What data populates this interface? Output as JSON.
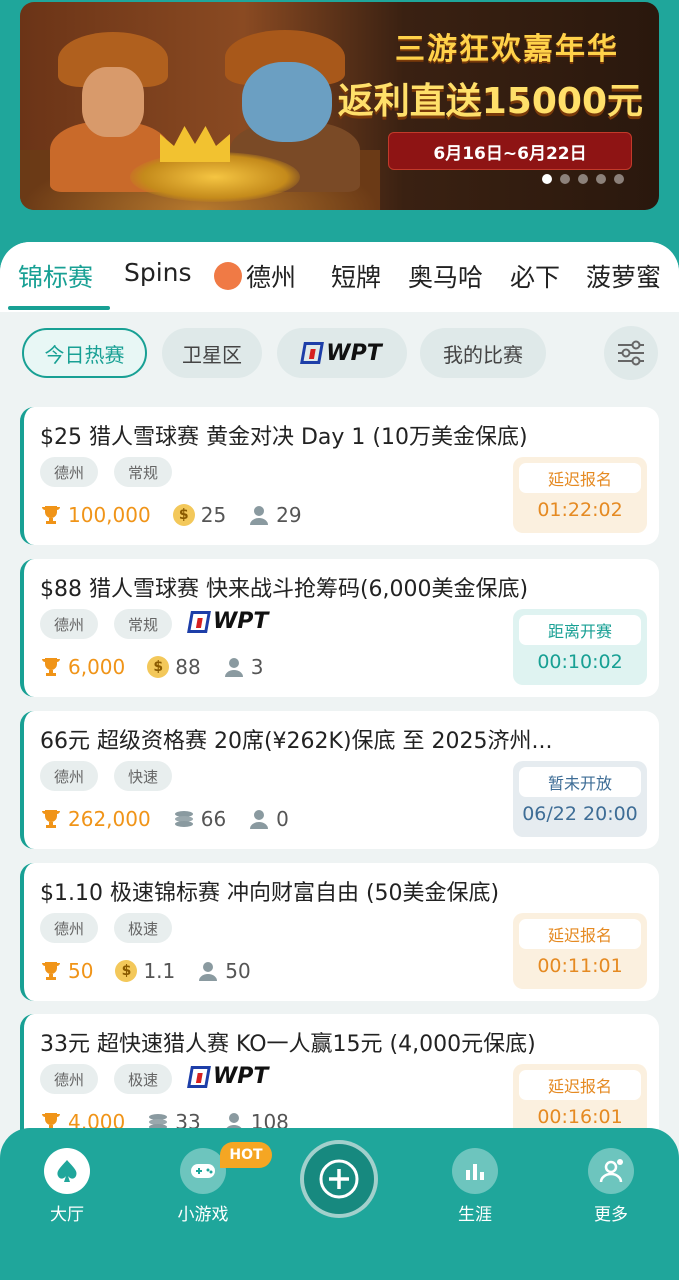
{
  "banner": {
    "headline_line1": "三游狂欢嘉年华",
    "headline_line2": "返利直送15000元",
    "date_range": "6月16日~6月22日",
    "slides": 5,
    "active_slide": 1
  },
  "tabs": [
    {
      "label": "锦标赛",
      "active": true
    },
    {
      "label": "Spins"
    },
    {
      "label": "德州",
      "icon": "octopus-icon"
    },
    {
      "label": "短牌"
    },
    {
      "label": "奥马哈"
    },
    {
      "label": "必下"
    },
    {
      "label": "菠萝蜜"
    }
  ],
  "filters": {
    "today": "今日热赛",
    "satellite": "卫星区",
    "wpt_logo_text": "WPT",
    "my_matches": "我的比赛",
    "settings_icon": "sliders-icon"
  },
  "cards": [
    {
      "title": "$25 猎人雪球赛 黄金对决 Day 1 (10万美金保底)",
      "tags": [
        "德州",
        "常规"
      ],
      "wpt": false,
      "prize": "100,000",
      "fee_icon": "coin",
      "fee": "25",
      "players": "29",
      "status": "延迟报名",
      "time": "01:22:02",
      "status_type": "late"
    },
    {
      "title": "$88 猎人雪球赛 快来战斗抢筹码(6,000美金保底)",
      "tags": [
        "德州",
        "常规"
      ],
      "wpt": true,
      "prize": "6,000",
      "fee_icon": "coin",
      "fee": "88",
      "players": "3",
      "status": "距离开赛",
      "time": "00:10:02",
      "status_type": "countdown"
    },
    {
      "title": "66元 超级资格赛 20席(¥262K)保底 至 2025济州...",
      "tags": [
        "德州",
        "快速"
      ],
      "wpt": false,
      "prize": "262,000",
      "fee_icon": "chips",
      "fee": "66",
      "players": "0",
      "status": "暂未开放",
      "time": "06/22 20:00",
      "status_type": "closed"
    },
    {
      "title": "$1.10 极速锦标赛 冲向财富自由 (50美金保底)",
      "tags": [
        "德州",
        "极速"
      ],
      "wpt": false,
      "prize": "50",
      "fee_icon": "coin",
      "fee": "1.1",
      "players": "50",
      "status": "延迟报名",
      "time": "00:11:01",
      "status_type": "late"
    },
    {
      "title": "33元 超快速猎人赛 KO一人赢15元 (4,000元保底)",
      "tags": [
        "德州",
        "极速"
      ],
      "wpt": true,
      "prize": "4,000",
      "fee_icon": "chips",
      "fee": "33",
      "players": "108",
      "status": "延迟报名",
      "time": "00:16:01",
      "status_type": "late"
    }
  ],
  "nav": {
    "lobby": "大厅",
    "minigames": "小游戏",
    "hot": "HOT",
    "career": "生涯",
    "more": "更多"
  },
  "colors": {
    "brand": "#1fa69b",
    "accent": "#18a094",
    "prize": "#f09418"
  }
}
